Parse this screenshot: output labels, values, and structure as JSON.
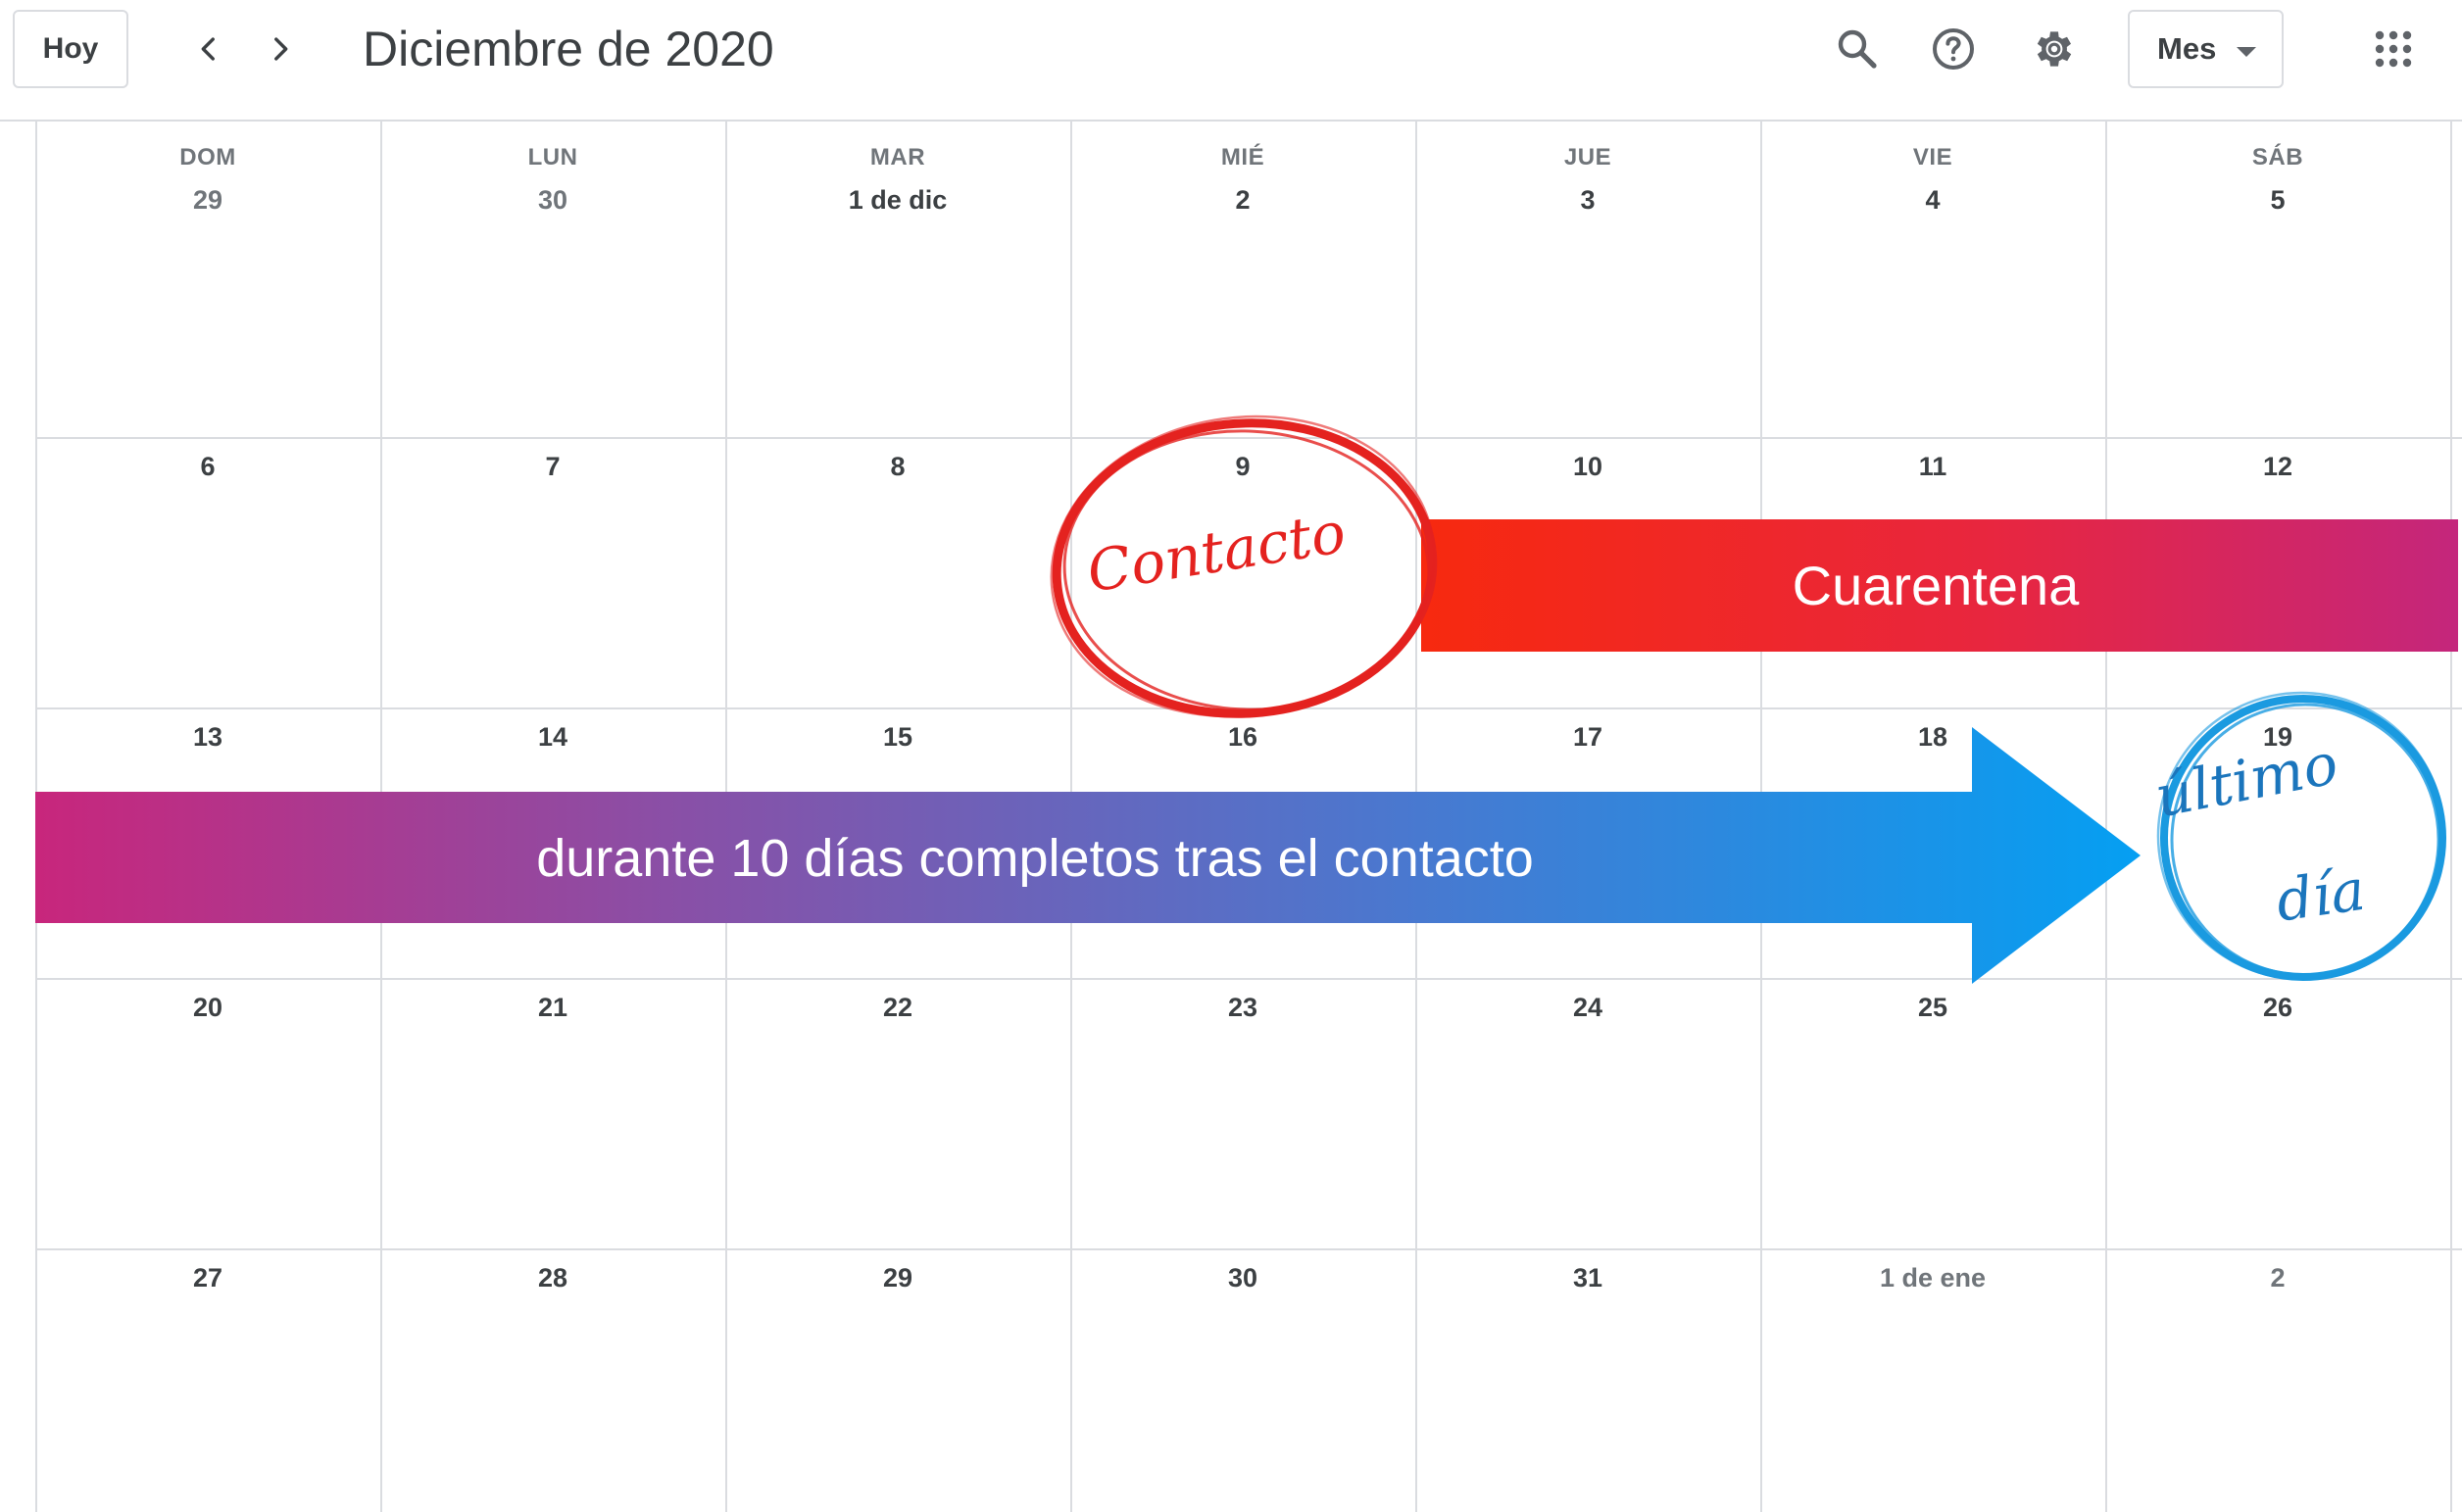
{
  "header": {
    "today_label": "Hoy",
    "prev_icon": "chevron-left-icon",
    "next_icon": "chevron-right-icon",
    "title": "Diciembre de 2020",
    "search_icon": "search-icon",
    "help_icon": "help-icon",
    "settings_icon": "gear-icon",
    "view_label": "Mes",
    "apps_icon": "apps-grid-icon"
  },
  "weekdays": [
    "DOM",
    "LUN",
    "MAR",
    "MIÉ",
    "JUE",
    "VIE",
    "SÁB"
  ],
  "weeks": [
    [
      "29",
      "30",
      "1 de dic",
      "2",
      "3",
      "4",
      "5"
    ],
    [
      "6",
      "7",
      "8",
      "9",
      "10",
      "11",
      "12"
    ],
    [
      "13",
      "14",
      "15",
      "16",
      "17",
      "18",
      "19"
    ],
    [
      "20",
      "21",
      "22",
      "23",
      "24",
      "25",
      "26"
    ],
    [
      "27",
      "28",
      "29",
      "30",
      "31",
      "1 de ene",
      "2"
    ]
  ],
  "annotations": {
    "contact_label": "Contacto",
    "quarantine_label": "Cuarentena",
    "duration_label": "durante 10 días completos tras el contacto",
    "last_day_line1": "último",
    "last_day_line2": "día"
  },
  "colors": {
    "contact_red": "#e4221f",
    "quarantine_start": "#f7290f",
    "quarantine_end": "#c4267c",
    "arrow_start": "#c8267c",
    "arrow_end": "#059ff2",
    "last_day_blue": "#1b75bc"
  }
}
